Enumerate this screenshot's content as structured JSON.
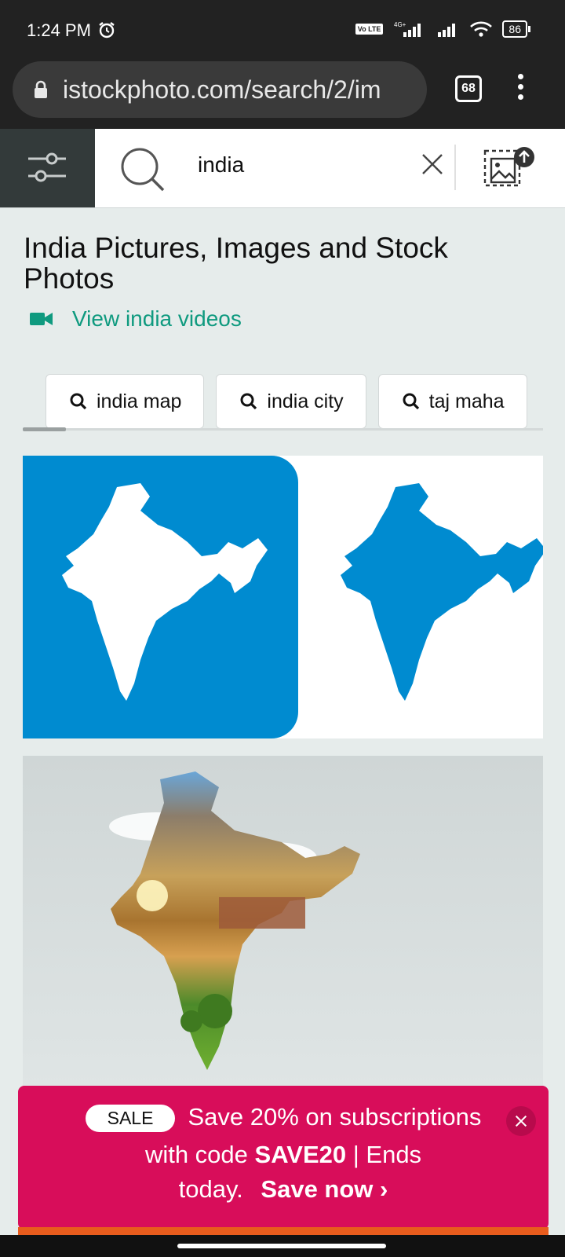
{
  "status_bar": {
    "time": "1:24 PM",
    "network": "4G+",
    "volte": "Vo LTE",
    "battery": "86"
  },
  "browser": {
    "url": "istockphoto.com/search/2/im",
    "tab_count": "68"
  },
  "search": {
    "query": "india"
  },
  "page": {
    "title": "India Pictures, Images and Stock Photos",
    "video_link": "View india videos",
    "chips": [
      "india map",
      "india city",
      "taj maha"
    ]
  },
  "banner": {
    "badge": "SALE",
    "line1": "Save 20% on subscriptions",
    "line2_prefix": "with code ",
    "code": "SAVE20",
    "line2_suffix": " | Ends",
    "line3": "today.",
    "cta": "Save now ›"
  },
  "colors": {
    "accent_green": "#0f9a7f",
    "map_blue": "#008bd0",
    "banner": "#d80d5a"
  }
}
